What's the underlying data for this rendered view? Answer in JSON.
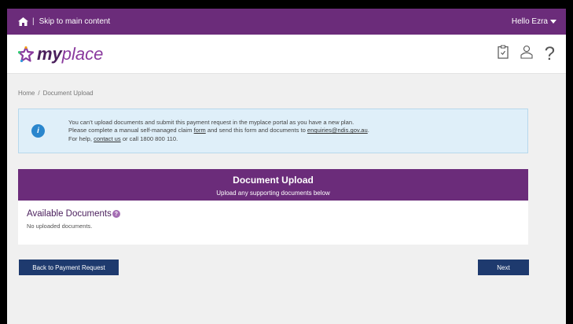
{
  "topbar": {
    "skip_link": "Skip to main content",
    "greeting": "Hello Ezra"
  },
  "header": {
    "logo_my": "my",
    "logo_place": "place",
    "help_icon": "?"
  },
  "breadcrumb": {
    "home": "Home",
    "separator": "/",
    "current": "Document Upload"
  },
  "alert": {
    "icon": "i",
    "line1": "You can’t upload documents and submit this payment request in the myplace portal as you have a new plan.",
    "line2_pre": "Please complete a manual self-managed claim ",
    "line2_link": "form",
    "line2_mid": " and send this form and documents to ",
    "line2_email": "enquiries@ndis.gov.au",
    "line2_post": ".",
    "line3_pre": "For help, ",
    "line3_link": "contact us",
    "line3_post": " or call 1800 800 110."
  },
  "panel": {
    "title": "Document Upload",
    "subtitle": "Upload any supporting documents below",
    "available_heading": "Available Documents",
    "help_badge": "?",
    "empty_text": "No uploaded documents."
  },
  "buttons": {
    "back": "Back to Payment Request",
    "next": "Next"
  },
  "colors": {
    "brand_purple": "#6b2c7a",
    "button_navy": "#1e3a6e",
    "info_blue": "#2a86cd",
    "alert_bg": "#dfeff9"
  }
}
